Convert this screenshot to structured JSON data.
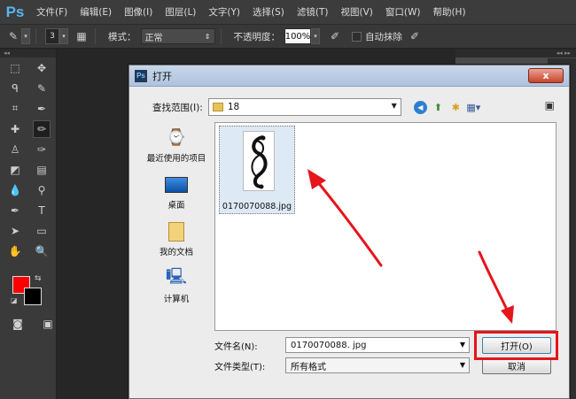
{
  "app": {
    "logo": "Ps",
    "menu": [
      "文件(F)",
      "编辑(E)",
      "图像(I)",
      "图层(L)",
      "文字(Y)",
      "选择(S)",
      "滤镜(T)",
      "视图(V)",
      "窗口(W)",
      "帮助(H)"
    ]
  },
  "options_bar": {
    "brush_size": "3",
    "mode_label": "模式：",
    "mode_value": "正常",
    "opacity_label": "不透明度：",
    "opacity_value": "100%",
    "auto_erase_label": "自动抹除"
  },
  "colors": {
    "foreground": "#ff0000",
    "background": "#000000",
    "annotation": "#e6141b"
  },
  "dialog": {
    "title": "打开",
    "close_label": "x",
    "look_in_label": "查找范围(I):",
    "look_in_value": "18",
    "places": [
      "最近使用的项目",
      "桌面",
      "我的文档",
      "计算机"
    ],
    "files": [
      {
        "name": "0170070088.jpg"
      }
    ],
    "file_name_label": "文件名(N):",
    "file_name_value": "0170070088. jpg",
    "file_type_label": "文件类型(T):",
    "file_type_value": "所有格式",
    "open_button": "打开(O)",
    "cancel_button": "取消"
  }
}
